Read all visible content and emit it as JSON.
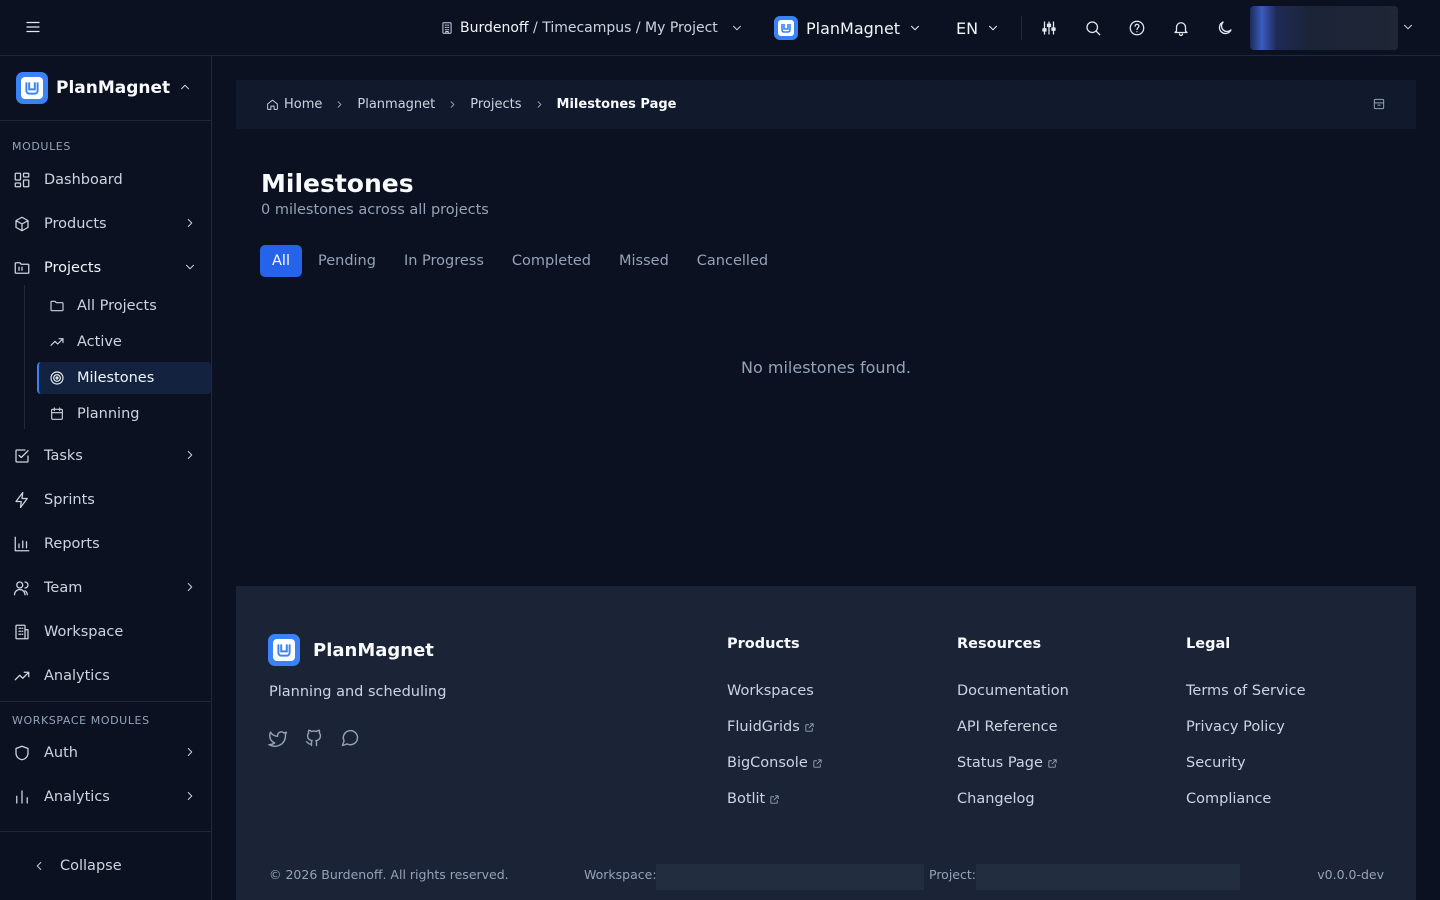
{
  "topbar": {
    "context": {
      "org": "Burdenoff",
      "rest": " / Timecampus / My Project"
    },
    "app_name": "PlanMagnet",
    "language": "EN"
  },
  "sidebar": {
    "brand": "PlanMagnet",
    "modules_label": "MODULES",
    "items": [
      {
        "label": "Dashboard"
      },
      {
        "label": "Products"
      },
      {
        "label": "Projects"
      },
      {
        "label": "Tasks"
      },
      {
        "label": "Sprints"
      },
      {
        "label": "Reports"
      },
      {
        "label": "Team"
      },
      {
        "label": "Workspace"
      },
      {
        "label": "Analytics"
      }
    ],
    "project_subitems": [
      {
        "label": "All Projects"
      },
      {
        "label": "Active"
      },
      {
        "label": "Milestones"
      },
      {
        "label": "Planning"
      }
    ],
    "workspace_modules_label": "WORKSPACE MODULES",
    "workspace_items": [
      {
        "label": "Auth"
      },
      {
        "label": "Analytics"
      }
    ],
    "collapse_label": "Collapse"
  },
  "breadcrumb": {
    "items": [
      "Home",
      "Planmagnet",
      "Projects"
    ],
    "current": "Milestones Page"
  },
  "page": {
    "title": "Milestones",
    "subtitle": "0 milestones across all projects",
    "tabs": [
      "All",
      "Pending",
      "In Progress",
      "Completed",
      "Missed",
      "Cancelled"
    ],
    "active_tab": "All",
    "empty_message": "No milestones found."
  },
  "footer": {
    "brand": "PlanMagnet",
    "tagline": "Planning and scheduling",
    "columns": [
      {
        "title": "Products",
        "links": [
          "Workspaces",
          "FluidGrids",
          "BigConsole",
          "Botlit"
        ]
      },
      {
        "title": "Resources",
        "links": [
          "Documentation",
          "API Reference",
          "Status Page",
          "Changelog"
        ]
      },
      {
        "title": "Legal",
        "links": [
          "Terms of Service",
          "Privacy Policy",
          "Security",
          "Compliance"
        ]
      }
    ],
    "copyright": "© 2026 Burdenoff. All rights reserved.",
    "workspace_label": "Workspace:",
    "project_label": "Project:",
    "version": "v0.0.0-dev"
  },
  "colors": {
    "background": "#0b1120",
    "accent": "#2563eb",
    "brand": "#3b82f6",
    "footer_bg": "#1a2436"
  },
  "icons": {
    "topbar": [
      "menu-icon",
      "building-icon",
      "chevron-down-icon",
      "sliders-icon",
      "search-icon",
      "help-circle-icon",
      "bell-icon",
      "moon-icon"
    ],
    "sidebar": [
      "dashboard-icon",
      "package-icon",
      "folder-icon",
      "check-square-icon",
      "zap-icon",
      "bar-chart-icon",
      "users-icon",
      "building-icon",
      "trending-up-icon",
      "shield-icon",
      "chevron-left-icon"
    ],
    "footer": [
      "twitter-icon",
      "github-icon",
      "message-circle-icon",
      "external-link-icon"
    ]
  }
}
